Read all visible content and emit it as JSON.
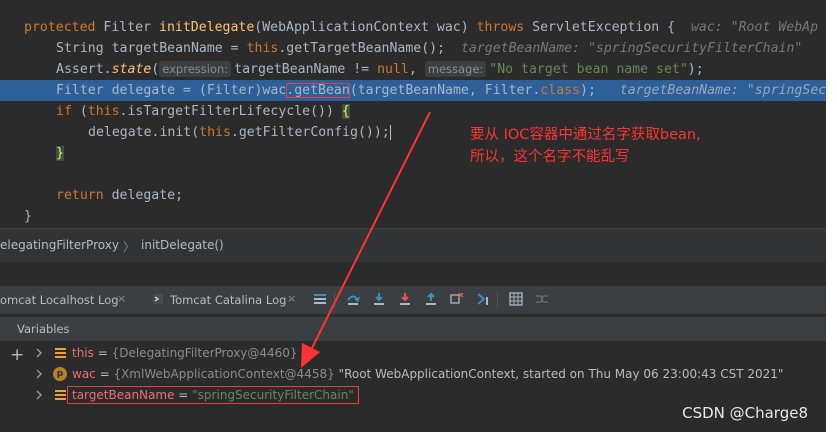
{
  "editor": {
    "line1": {
      "kw1": "protected",
      "text1": " Filter ",
      "fn": "initDelegate",
      "text2": "(WebApplicationContext wac) ",
      "kw2": "throws",
      "text3": " ServletException {",
      "hint": "wac: \"Root WebAp"
    },
    "line2": {
      "text1": "String targetBeanName = ",
      "kw": "this",
      "text2": ".getTargetBeanName();",
      "hint": "targetBeanName: \"springSecurityFilterChain\""
    },
    "line3": {
      "text1": "Assert.",
      "fn": "state",
      "text2": "(",
      "param1": "expression:",
      "text3": "targetBeanName != ",
      "kw": "null",
      "text4": ",",
      "param2": "message:",
      "str": "\"No target bean name set\"",
      "text5": ");"
    },
    "line4": {
      "text1": "Filter delegate = (Filter)wac",
      "boxed": ".getBean",
      "text2": "(targetBeanName, Filter.",
      "kw": "class",
      "text3": ");",
      "hint": "targetBeanName: \"springSec"
    },
    "line5": {
      "kw1": "if",
      "text1": " (",
      "kw2": "this",
      "text2": ".isTargetFilterLifecycle()) ",
      "brace": "{"
    },
    "line6": {
      "text1": "delegate.init(",
      "kw": "this",
      "text2": ".getFilterConfig());"
    },
    "line7": {
      "brace": "}"
    },
    "line9": {
      "kw": "return",
      "text": " delegate;"
    },
    "line10": {
      "text": "}"
    }
  },
  "breadcrumb": {
    "class_name": "elegatingFilterProxy",
    "separator": "〉",
    "method": "initDelegate()"
  },
  "debug_tabs": [
    {
      "label": "omcat Localhost Log",
      "close": "×"
    },
    {
      "label": "Tomcat Catalina Log",
      "close": "×"
    }
  ],
  "variables": {
    "header": "Variables",
    "rows": [
      {
        "name": "this",
        "eq": " = ",
        "value": "{DelegatingFilterProxy@4460}",
        "extra": ""
      },
      {
        "name": "wac",
        "eq": " = ",
        "value": "{XmlWebApplicationContext@4458}",
        "extra": " \"Root WebApplicationContext, started on Thu May 06 23:00:43 CST 2021\""
      },
      {
        "name": "targetBeanName",
        "eq": " = ",
        "value": "\"springSecurityFilterChain\"",
        "extra": ""
      }
    ]
  },
  "annotation": {
    "line1": "要从 IOC容器中通过名字获取bean,",
    "line2": "所以，这个名字不能乱写"
  },
  "watermark": "CSDN @Charge8"
}
